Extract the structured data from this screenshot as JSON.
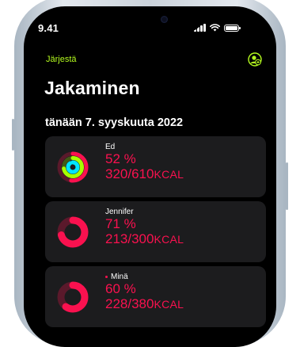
{
  "status_bar": {
    "time": "9.41"
  },
  "nav": {
    "left_label": "Järjestä",
    "right_icon": "add-person-icon"
  },
  "page": {
    "title": "Jakaminen",
    "date": "tänään 7. syyskuuta 2022"
  },
  "colors": {
    "accent": "#b4fb1f",
    "move": "#fa114f",
    "exercise": "#a6ff00",
    "stand": "#00e5ff",
    "background": "#000000",
    "card": "#1c1c1e"
  },
  "cards": [
    {
      "name": "Ed",
      "percent": "52 %",
      "kcal_value": "320/610",
      "kcal_unit": "KCAL",
      "rings": {
        "move": 0.52,
        "exercise": 0.72,
        "stand": 0.9
      }
    },
    {
      "name": "Jennifer",
      "percent": "71 %",
      "kcal_value": "213/300",
      "kcal_unit": "KCAL",
      "rings": {
        "move": 0.71
      }
    },
    {
      "name": "Minä",
      "percent": "60 %",
      "kcal_value": "228/380",
      "kcal_unit": "KCAL",
      "rings": {
        "move": 0.6
      }
    }
  ]
}
